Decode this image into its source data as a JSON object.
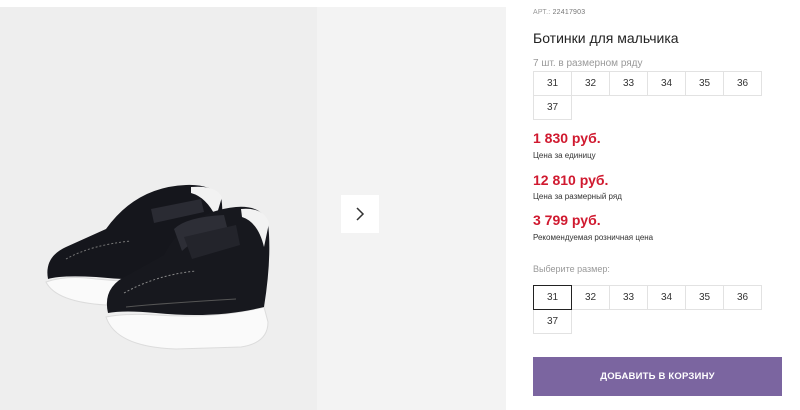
{
  "product": {
    "article_label": "АРТ.:",
    "article_number": "22417903",
    "title": "Ботинки для мальчика",
    "pack_note": "7 шт. в размерном ряду",
    "pack_sizes": [
      "31",
      "32",
      "33",
      "34",
      "35",
      "36",
      "37"
    ]
  },
  "prices": [
    {
      "value": "1 830 руб.",
      "label": "Цена за единицу"
    },
    {
      "value": "12 810 руб.",
      "label": "Цена за размерный ряд"
    },
    {
      "value": "3 799 руб.",
      "label": "Рекомендуемая розничная цена"
    }
  ],
  "size_select": {
    "label": "Выберите размер:",
    "options": [
      "31",
      "32",
      "33",
      "34",
      "35",
      "36",
      "37"
    ],
    "selected": "31"
  },
  "actions": {
    "add_to_cart": "ДОБАВИТЬ В КОРЗИНУ"
  },
  "icons": {
    "gallery_next": "chevron-right-icon"
  },
  "colors": {
    "price": "#d0192f",
    "button": "#7b65a0"
  }
}
